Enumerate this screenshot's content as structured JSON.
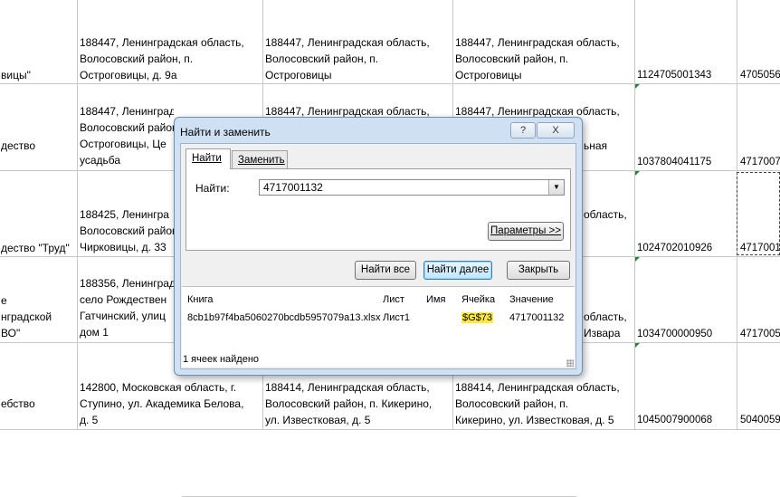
{
  "sheet": {
    "rows": [
      {
        "col_a": [
          "",
          "",
          "вицы\""
        ],
        "col_b": [
          "188447, Ленинградская область,",
          "Волосовский район, п.",
          "Острогoвицы, д. 9а"
        ],
        "col_c": [
          "188447, Ленинградская область,",
          "Волосовский район, п.",
          "Остроговицы"
        ],
        "col_d": [
          "188447, Ленинградская область,",
          "Волосовский район, п.",
          "Остроговицы"
        ],
        "col_e": "1124705001343",
        "col_f": "4705056"
      },
      {
        "col_a": [
          "",
          "дество",
          ""
        ],
        "col_b": [
          "188447, Ленинград",
          "Волосовский район",
          "Остроговицы, Це",
          "усадьба"
        ],
        "col_c": [
          "188447, Ленинградская область,"
        ],
        "col_d": [
          "188447, Ленинградская область,",
          "",
          "ьная"
        ],
        "col_e": "1037804041175",
        "col_f": "4717007"
      },
      {
        "col_a": [
          "",
          "",
          "дество \"Труд\""
        ],
        "col_b": [
          "188425, Ленингра",
          "Волосовский район",
          "Чирковицы, д. 33"
        ],
        "col_d": [
          "область,"
        ],
        "col_e": "1024702010926",
        "col_f": "4717001"
      },
      {
        "col_a": [
          "",
          "е",
          "нградской",
          "ВО\""
        ],
        "col_b": [
          "188356, Ленинград",
          "село Рождествен",
          "Гатчинский, улиц",
          "дом 1"
        ],
        "col_d": [
          "область,",
          "Извара"
        ],
        "col_e": "1034700000950",
        "col_f": "4717005"
      },
      {
        "col_a": [
          "",
          "ебство",
          ""
        ],
        "col_b": [
          "142800, Московская область, г.",
          "Ступино, ул. Академика Белова,",
          "д. 5"
        ],
        "col_c": [
          "188414, Ленинградская область,",
          "Волосовский район, п. Кикерино,",
          "ул. Известковая, д. 5"
        ],
        "col_d": [
          "188414, Ленинградская область,",
          "Волосовский район, п.",
          "Кикерино, ул. Известковая, д. 5"
        ],
        "col_e": "1045007900068",
        "col_f": "5040059"
      }
    ]
  },
  "dialog": {
    "title": "Найти и заменить",
    "help_label": "?",
    "close_label": "X",
    "tab_find": "Найти",
    "tab_replace": "Заменить",
    "find_label": "Найти:",
    "find_value": "4717001132",
    "params_button": "Параметры >>",
    "find_all_button": "Найти все",
    "find_next_button": "Найти далее",
    "close_button": "Закрыть",
    "results_headers": [
      "Книга",
      "Лист",
      "Имя",
      "Ячейка",
      "Значение"
    ],
    "results_row": {
      "book": "8cb1b97f4ba5060270bcdb5957079a13.xlsx",
      "sheet": "Лист1",
      "name": "",
      "cell": "$G$73",
      "value": "4717001132"
    },
    "status": "1 ячеек найдено"
  }
}
